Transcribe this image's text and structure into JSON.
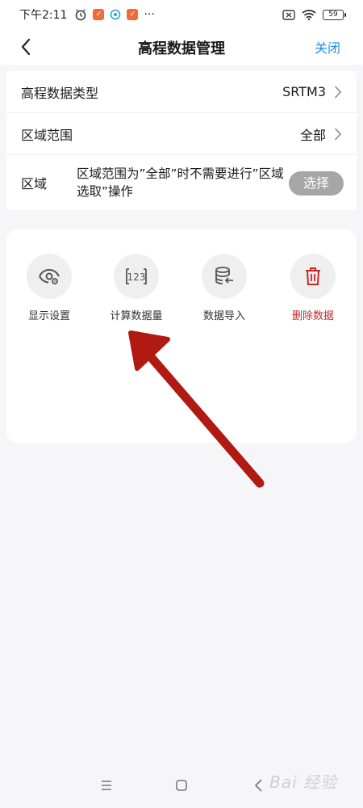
{
  "status_bar": {
    "time": "下午2:11",
    "more": "···",
    "battery": "59"
  },
  "header": {
    "title": "高程数据管理",
    "close_label": "关闭"
  },
  "settings": {
    "rows": [
      {
        "label": "高程数据类型",
        "value": "SRTM3"
      },
      {
        "label": "区域范围",
        "value": "全部"
      }
    ],
    "area": {
      "label": "区域",
      "description": "区域范围为”全部”时不需要进行”区域选取”操作",
      "select_label": "选择"
    }
  },
  "actions": [
    {
      "label": "显示设置",
      "icon": "eye-settings-icon"
    },
    {
      "label": "计算数据量",
      "icon": "count-123-icon"
    },
    {
      "label": "数据导入",
      "icon": "database-import-icon"
    },
    {
      "label": "删除数据",
      "icon": "trash-icon"
    }
  ],
  "colors": {
    "accent": "#1d8fe6",
    "danger": "#c62828",
    "annotation_arrow": "#b01a12"
  },
  "watermark": "Bai 经验"
}
